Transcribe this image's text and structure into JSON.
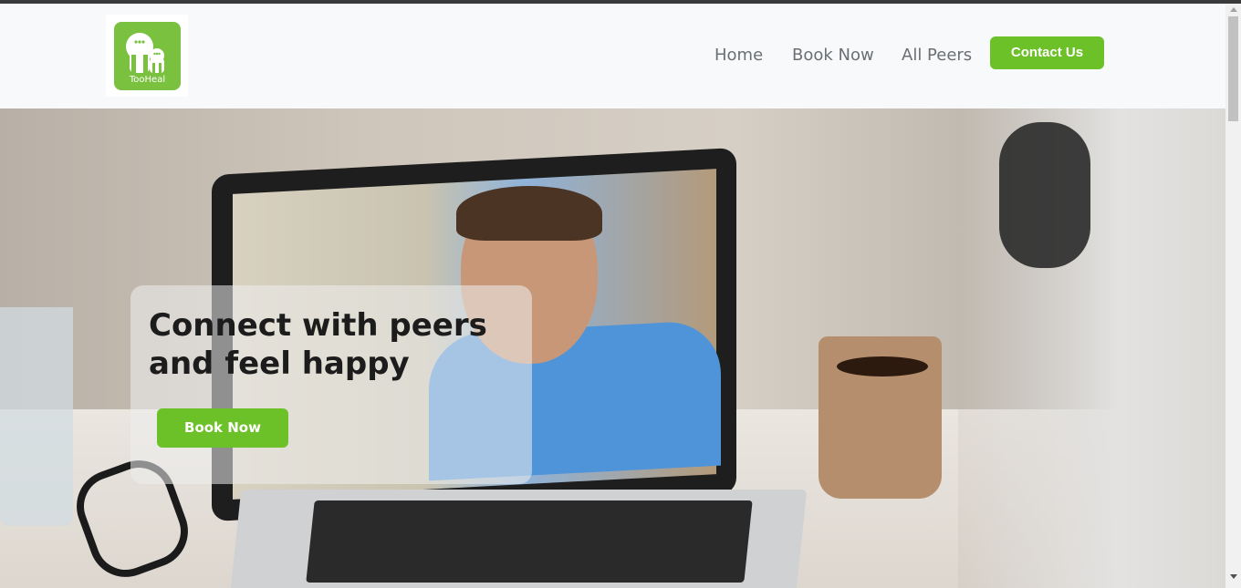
{
  "brand": {
    "logo_text": "TooHeal"
  },
  "nav": {
    "home": "Home",
    "book_now": "Book Now",
    "all_peers": "All Peers",
    "contact_us": "Contact Us"
  },
  "hero": {
    "title": "Connect with peers and feel happy",
    "button_label": "Book Now"
  },
  "colors": {
    "brand_green": "#6dc128",
    "logo_green": "#7ac13f",
    "nav_text": "#6b6f73",
    "navbar_bg": "#f8f9fa"
  },
  "icons": [
    "tooheal-logo-icon",
    "scroll-up-arrow-icon",
    "scroll-down-arrow-icon"
  ]
}
